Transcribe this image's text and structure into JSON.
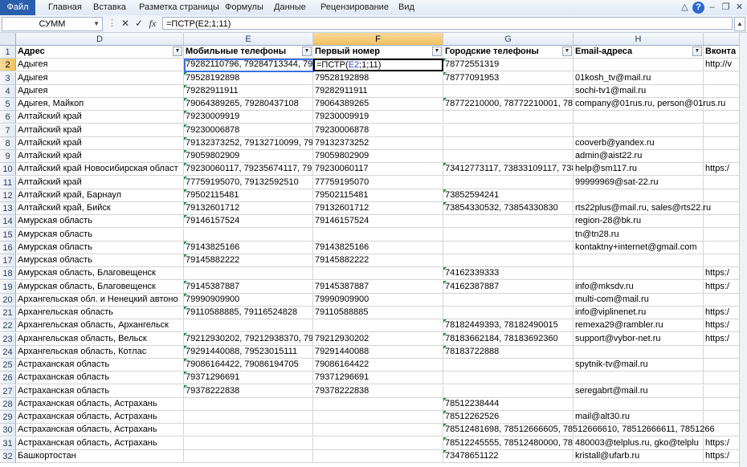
{
  "ribbon": {
    "file_tab": "Файл",
    "tabs": [
      "Главная",
      "Вставка",
      "Разметка страницы",
      "Формулы",
      "Данные",
      "Рецензирование",
      "Вид"
    ]
  },
  "formula_bar": {
    "name_box": "СУММ",
    "cancel": "✕",
    "enter": "✓",
    "fx": "fx",
    "formula": "=ПСТР(E2;1;11)"
  },
  "columns": [
    "D",
    "E",
    "F",
    "G",
    "H"
  ],
  "selected_column": "F",
  "header_row": {
    "D": "Адрес",
    "E": "Мобильные телефоны",
    "F": "Первый номер",
    "G": "Городские телефоны",
    "H": "Email-адреса",
    "I": "Вконта"
  },
  "active_cell_text": {
    "prefix": "=ПСТР(",
    "ref": "E2",
    "suffix": ";1;11)"
  },
  "rows": [
    {
      "n": "2",
      "D": "Адыгея",
      "E": "79282110796, 79284713344, 7928",
      "F": "",
      "G": "78772551319",
      "H": "",
      "I": "http://v"
    },
    {
      "n": "3",
      "D": "Адыгея",
      "E": "79528192898",
      "F": "79528192898",
      "G": "78777091953",
      "H": "01kosh_tv@mail.ru",
      "I": ""
    },
    {
      "n": "4",
      "D": "Адыгея",
      "E": "79282911911",
      "F": "79282911911",
      "G": "",
      "H": "sochi-tv1@mail.ru",
      "I": ""
    },
    {
      "n": "5",
      "D": "Адыгея, Майкоп",
      "E": "79064389265, 79280437108",
      "F": "79064389265",
      "G": "78772210000, 78772210001, 7877",
      "H": "company@01rus.ru, person@01rus.ru",
      "I": ""
    },
    {
      "n": "6",
      "D": "Алтайский край",
      "E": "79230009919",
      "F": "79230009919",
      "G": "",
      "H": "",
      "I": ""
    },
    {
      "n": "7",
      "D": "Алтайский край",
      "E": "79230006878",
      "F": "79230006878",
      "G": "",
      "H": "",
      "I": ""
    },
    {
      "n": "8",
      "D": "Алтайский край",
      "E": "79132373252, 79132710099, 7983",
      "F": "79132373252",
      "G": "",
      "H": "cooverb@yandex.ru",
      "I": ""
    },
    {
      "n": "9",
      "D": "Алтайский край",
      "E": "79059802909",
      "F": "79059802909",
      "G": "",
      "H": "admin@aist22.ru",
      "I": ""
    },
    {
      "n": "10",
      "D": "Алтайский край Новосибирская област",
      "E": "79230060117, 79235674117, 7923",
      "F": "79230060117",
      "G": "73412773117, 73833109117, 7384",
      "H": "help@sm117.ru",
      "I": "https:/"
    },
    {
      "n": "11",
      "D": "Алтайский край",
      "E": "77759195070, 79132592510",
      "F": "77759195070",
      "G": "",
      "H": "99999969@sat-22.ru",
      "I": ""
    },
    {
      "n": "12",
      "D": "Алтайский край, Барнаул",
      "E": "79502115481",
      "F": "79502115481",
      "G": "73852594241",
      "H": "",
      "I": ""
    },
    {
      "n": "13",
      "D": "Алтайский край, Бийск",
      "E": "79132601712",
      "F": "79132601712",
      "G": "73854330532, 73854330830",
      "H": "rts22plus@mail.ru, sales@rts22.ru",
      "I": ""
    },
    {
      "n": "14",
      "D": "Амурская область",
      "E": "79146157524",
      "F": "79146157524",
      "G": "",
      "H": "region-28@bk.ru",
      "I": ""
    },
    {
      "n": "15",
      "D": "Амурская область",
      "E": "",
      "F": "",
      "G": "",
      "H": "tn@tn28.ru",
      "I": ""
    },
    {
      "n": "16",
      "D": "Амурская область",
      "E": "79143825166",
      "F": "79143825166",
      "G": "",
      "H": "kontaktny+internet@gmail.com",
      "I": ""
    },
    {
      "n": "17",
      "D": "Амурская область",
      "E": "79145882222",
      "F": "79145882222",
      "G": "",
      "H": "",
      "I": ""
    },
    {
      "n": "18",
      "D": "Амурская область, Благовещенск",
      "E": "",
      "F": "",
      "G": "74162339333",
      "H": "",
      "I": "https:/"
    },
    {
      "n": "19",
      "D": "Амурская область, Благовещенск",
      "E": "79145387887",
      "F": "79145387887",
      "G": "74162387887",
      "H": "info@mksdv.ru",
      "I": "https:/"
    },
    {
      "n": "20",
      "D": "Архангельская обл. и Ненецкий автоно",
      "E": "79990909900",
      "F": "79990909900",
      "G": "",
      "H": "multi-com@mail.ru",
      "I": ""
    },
    {
      "n": "21",
      "D": "Архангельская область",
      "E": "79110588885, 79116524828",
      "F": "79110588885",
      "G": "",
      "H": "info@viplinenet.ru",
      "I": "https:/"
    },
    {
      "n": "22",
      "D": "Архангельская область, Архангельск",
      "E": "",
      "F": "",
      "G": "78182449393, 78182490015",
      "H": "remexa29@rambler.ru",
      "I": "https:/"
    },
    {
      "n": "23",
      "D": "Архангельская область, Вельск",
      "E": "79212930202, 79212938370, 7960",
      "F": "79212930202",
      "G": "78183662184, 78183692360",
      "H": "support@vybor-net.ru",
      "I": "https:/"
    },
    {
      "n": "24",
      "D": "Архангельская область, Котлас",
      "E": "79291440088, 79523015111",
      "F": "79291440088",
      "G": "78183722888",
      "H": "",
      "I": ""
    },
    {
      "n": "25",
      "D": "Астраханская область",
      "E": "79086164422, 79086194705",
      "F": "79086164422",
      "G": "",
      "H": "spytnik-tv@mail.ru",
      "I": ""
    },
    {
      "n": "26",
      "D": "Астраханская область",
      "E": "79371296691",
      "F": "79371296691",
      "G": "",
      "H": "",
      "I": ""
    },
    {
      "n": "27",
      "D": "Астраханская область",
      "E": "79378222838",
      "F": "79378222838",
      "G": "",
      "H": "seregabrt@mail.ru",
      "I": ""
    },
    {
      "n": "28",
      "D": "Астраханская область, Астрахань",
      "E": "",
      "F": "",
      "G": "78512238444",
      "H": "",
      "I": ""
    },
    {
      "n": "29",
      "D": "Астраханская область, Астрахань",
      "E": "",
      "F": "",
      "G": "78512262526",
      "H": "mail@alt30.ru",
      "I": ""
    },
    {
      "n": "30",
      "D": "Астраханская область, Астрахань",
      "E": "",
      "F": "",
      "G": "78512481698, 78512666605, 78512666610, 78512666611, 7851266",
      "H": "",
      "I": ""
    },
    {
      "n": "31",
      "D": "Астраханская область, Астрахань",
      "E": "",
      "F": "",
      "G": "78512245555, 78512480000, 7851",
      "H": "480003@telplus.ru, gko@telplu",
      "I": "https:/"
    },
    {
      "n": "32",
      "D": "Башкортостан",
      "E": "",
      "F": "",
      "G": "73478651122",
      "H": "kristall@ufarb.ru",
      "I": "https:/"
    }
  ],
  "colors": {
    "selection_orange": "#f1c15f",
    "ref_blue": "#3a6fe0",
    "error_triangle": "#1f8f3a"
  }
}
